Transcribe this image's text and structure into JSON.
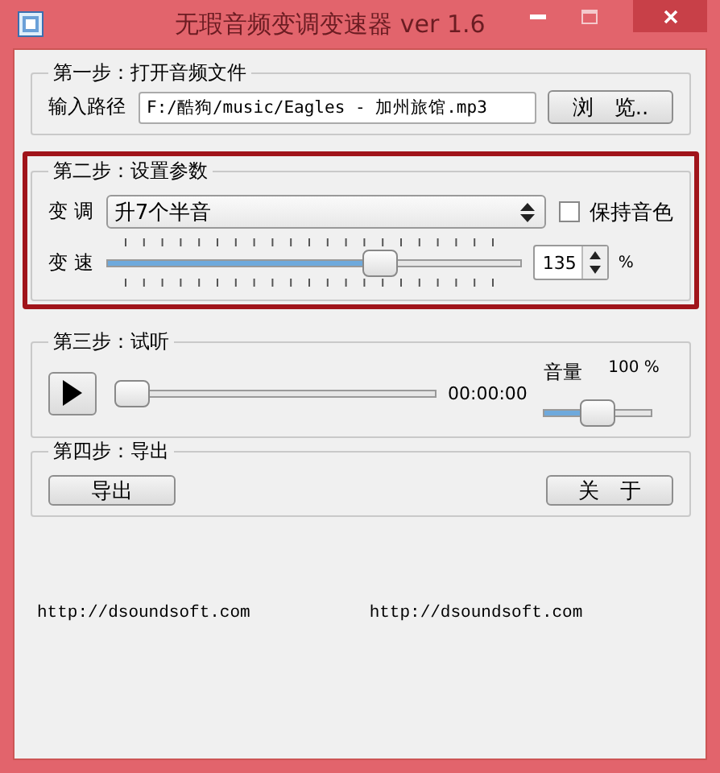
{
  "window": {
    "title": "无瑕音频变调变速器 ver 1.6"
  },
  "step1": {
    "legend": "第一步：打开音频文件",
    "path_label": "输入路径",
    "path_value": "F:/酷狗/music/Eagles - 加州旅馆.mp3",
    "browse_button": "浏　览.."
  },
  "step2": {
    "legend": "第二步：设置参数",
    "highlighted": true,
    "pitch_label": "变 调",
    "pitch_value": "升7个半音",
    "keep_timbre": {
      "label": "保持音色",
      "checked": false
    },
    "speed_label": "变 速",
    "speed": {
      "level": 0.66
    },
    "speed_value": "135",
    "speed_unit": "%"
  },
  "step3": {
    "legend": "第三步：试听",
    "position": {
      "level": 0
    },
    "time": "00:00:00",
    "volume_label": "音量",
    "volume_value": "100 %",
    "volume": {
      "level": 0.5
    }
  },
  "step4": {
    "legend": "第四步：导出",
    "export_button": "导出",
    "about_button": "关　于"
  },
  "footer": [
    "http://dsoundsoft.com",
    "http://dsoundsoft.com"
  ]
}
